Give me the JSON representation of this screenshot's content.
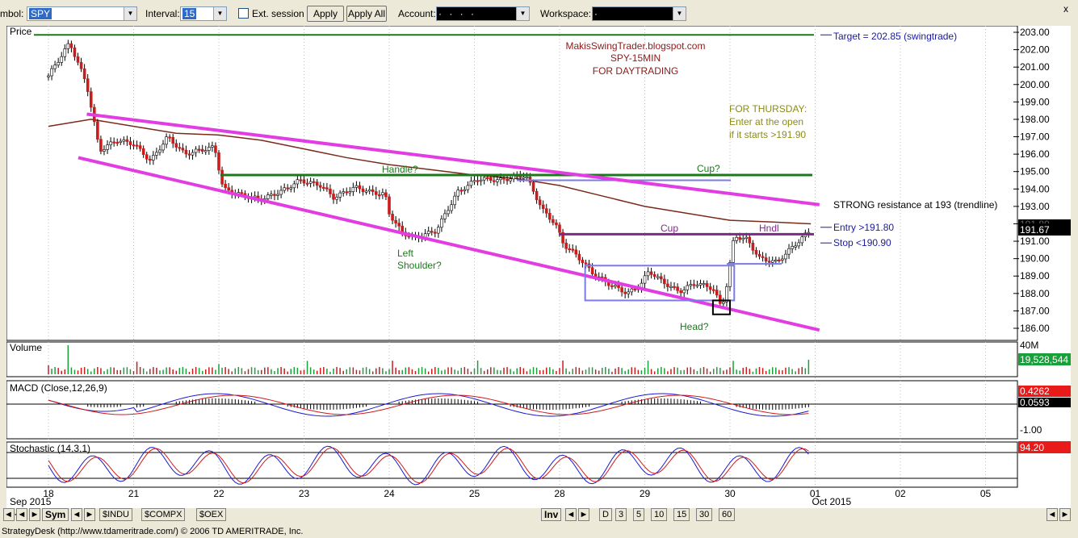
{
  "toolbar": {
    "symbol_label": "mbol:",
    "symbol_value": "SPY",
    "interval_label": "Interval:",
    "interval_value": "15",
    "ext_session_label": "Ext. session",
    "apply_label": "Apply",
    "apply_all_label": "Apply All",
    "account_label": "Account:",
    "account_value": "· · · ·",
    "workspace_label": "Workspace:",
    "workspace_value": "·",
    "close_glyph": "x"
  },
  "annotations": {
    "blog": "MakisSwingTrader.blogspot.com",
    "symbol_tf": "SPY-15MIN",
    "purpose": "FOR DAYTRADING",
    "thursday1": "FOR THURSDAY:",
    "thursday2": "Enter at the open",
    "thursday3": "if it starts >191.90",
    "target": "Target = 202.85 (swingtrade)",
    "resistance": "STRONG resistance at 193 (trendline)",
    "entry": "Entry >191.80",
    "stop": "Stop <190.90",
    "handle": "Handle?",
    "cup_q": "Cup?",
    "cup": "Cup",
    "hndl": "Hndl",
    "left1": "Left",
    "left2": "Shoulder?",
    "head": "Head?"
  },
  "panels": {
    "price_title": "Price",
    "volume_title": "Volume",
    "volume_axis_top": "40M",
    "volume_last": "19,528,544",
    "macd_title": "MACD (Close,12,26,9)",
    "macd_val1": "0.4262",
    "macd_val2": "0.0593",
    "macd_axis": "-1.00",
    "stoch_title": "Stochastic (14,3,1)",
    "stoch_val": "94.20",
    "last_price": "191.67",
    "hidden_price": "191.80"
  },
  "colors": {
    "magenta": "#e23ce3",
    "green": "#1a7a1a",
    "up": "#2a2a2a",
    "down": "#cc1b1b",
    "ma": "#7b2a1a",
    "box": "#7b7be8",
    "purple": "#7d2a86",
    "annot_red": "#8b1a1a",
    "annot_olive": "#8b8b1a",
    "annot_blue": "#1a1aa0"
  },
  "chart_data": {
    "type": "candlestick",
    "symbol": "SPY",
    "interval": "15",
    "y_ticks": [
      203,
      202,
      201,
      200,
      199,
      198,
      197,
      196,
      195,
      194,
      193,
      192,
      191,
      190,
      189,
      188,
      187,
      186
    ],
    "y_tick_labels": [
      "203.00",
      "202.00",
      "201.00",
      "200.00",
      "199.00",
      "198.00",
      "197.00",
      "196.00",
      "195.00",
      "194.00",
      "193.00",
      "",
      "191.00",
      "190.00",
      "189.00",
      "188.00",
      "187.00",
      "186.00"
    ],
    "ylim": [
      185.4,
      203.2
    ],
    "x_days": [
      "18",
      "21",
      "22",
      "23",
      "24",
      "25",
      "28",
      "29",
      "30",
      "01",
      "02",
      "05"
    ],
    "x_months": [
      "Sep 2015",
      "Oct 2015"
    ],
    "close_path": [
      [
        0,
        200.5
      ],
      [
        0.25,
        202.4
      ],
      [
        0.45,
        200.0
      ],
      [
        0.6,
        196.2
      ],
      [
        0.8,
        196.8
      ],
      [
        1.0,
        196.6
      ],
      [
        1.2,
        195.6
      ],
      [
        1.4,
        197.0
      ],
      [
        1.6,
        196.0
      ],
      [
        1.75,
        196.2
      ],
      [
        1.95,
        196.4
      ],
      [
        2.05,
        194.0
      ],
      [
        2.3,
        193.6
      ],
      [
        2.5,
        193.4
      ],
      [
        2.75,
        193.9
      ],
      [
        2.95,
        194.5
      ],
      [
        3.2,
        194.2
      ],
      [
        3.35,
        193.5
      ],
      [
        3.6,
        194.1
      ],
      [
        3.8,
        193.8
      ],
      [
        3.95,
        193.7
      ],
      [
        4.0,
        192.6
      ],
      [
        4.15,
        191.5
      ],
      [
        4.3,
        191.2
      ],
      [
        4.55,
        191.6
      ],
      [
        4.8,
        193.8
      ],
      [
        4.95,
        194.3
      ],
      [
        5.05,
        194.6
      ],
      [
        5.3,
        194.5
      ],
      [
        5.6,
        194.8
      ],
      [
        5.8,
        192.8
      ],
      [
        5.95,
        192.0
      ],
      [
        6.05,
        190.8
      ],
      [
        6.2,
        190.2
      ],
      [
        6.4,
        189.1
      ],
      [
        6.6,
        188.5
      ],
      [
        6.8,
        188.0
      ],
      [
        6.95,
        188.5
      ],
      [
        7.05,
        189.3
      ],
      [
        7.2,
        188.7
      ],
      [
        7.4,
        188.1
      ],
      [
        7.6,
        188.6
      ],
      [
        7.8,
        188.3
      ],
      [
        7.9,
        187.2
      ],
      [
        7.95,
        188.1
      ],
      [
        8.05,
        191.3
      ],
      [
        8.2,
        191.1
      ],
      [
        8.35,
        190.0
      ],
      [
        8.55,
        189.8
      ],
      [
        8.7,
        190.5
      ],
      [
        8.85,
        191.2
      ],
      [
        8.95,
        191.67
      ]
    ],
    "moving_average": [
      [
        0,
        197.6
      ],
      [
        0.5,
        198.0
      ],
      [
        1.0,
        197.6
      ],
      [
        1.5,
        197.2
      ],
      [
        2.0,
        197.1
      ],
      [
        2.5,
        196.8
      ],
      [
        3.0,
        196.3
      ],
      [
        3.5,
        195.8
      ],
      [
        4.0,
        195.4
      ],
      [
        4.5,
        195.1
      ],
      [
        5.0,
        194.8
      ],
      [
        5.5,
        194.6
      ],
      [
        6.0,
        194.2
      ],
      [
        6.5,
        193.6
      ],
      [
        7.0,
        193.0
      ],
      [
        7.5,
        192.6
      ],
      [
        8.0,
        192.2
      ],
      [
        8.5,
        192.1
      ],
      [
        8.95,
        192.0
      ]
    ],
    "levels": {
      "target": 202.85,
      "handle_line": 194.8,
      "cup_line": 191.4,
      "entry": 191.8,
      "stop": 190.9,
      "resistance": 193
    },
    "trendlines": [
      {
        "name": "upper",
        "from": [
          0.45,
          198.3
        ],
        "to": [
          9.05,
          193.1
        ]
      },
      {
        "name": "lower",
        "from": [
          0.35,
          195.8
        ],
        "to": [
          9.05,
          185.9
        ]
      }
    ],
    "boxes": [
      {
        "name": "consolidation",
        "x": [
          6.3,
          8.05
        ],
        "y": [
          187.6,
          189.6
        ]
      },
      {
        "name": "head",
        "x": [
          7.8,
          8.0
        ],
        "y": [
          186.8,
          187.6
        ]
      }
    ],
    "volume_spike_day": 0.22
  },
  "bottom": {
    "tabs": [
      "Sym",
      "$INDU",
      "$COMPX",
      "$OEX"
    ],
    "inv": "Inv",
    "periods": [
      "D",
      "3",
      "5",
      "10",
      "15",
      "30",
      "60"
    ],
    "status": "StrategyDesk (http://www.tdameritrade.com/) © 2006 TD AMERITRADE, Inc."
  }
}
